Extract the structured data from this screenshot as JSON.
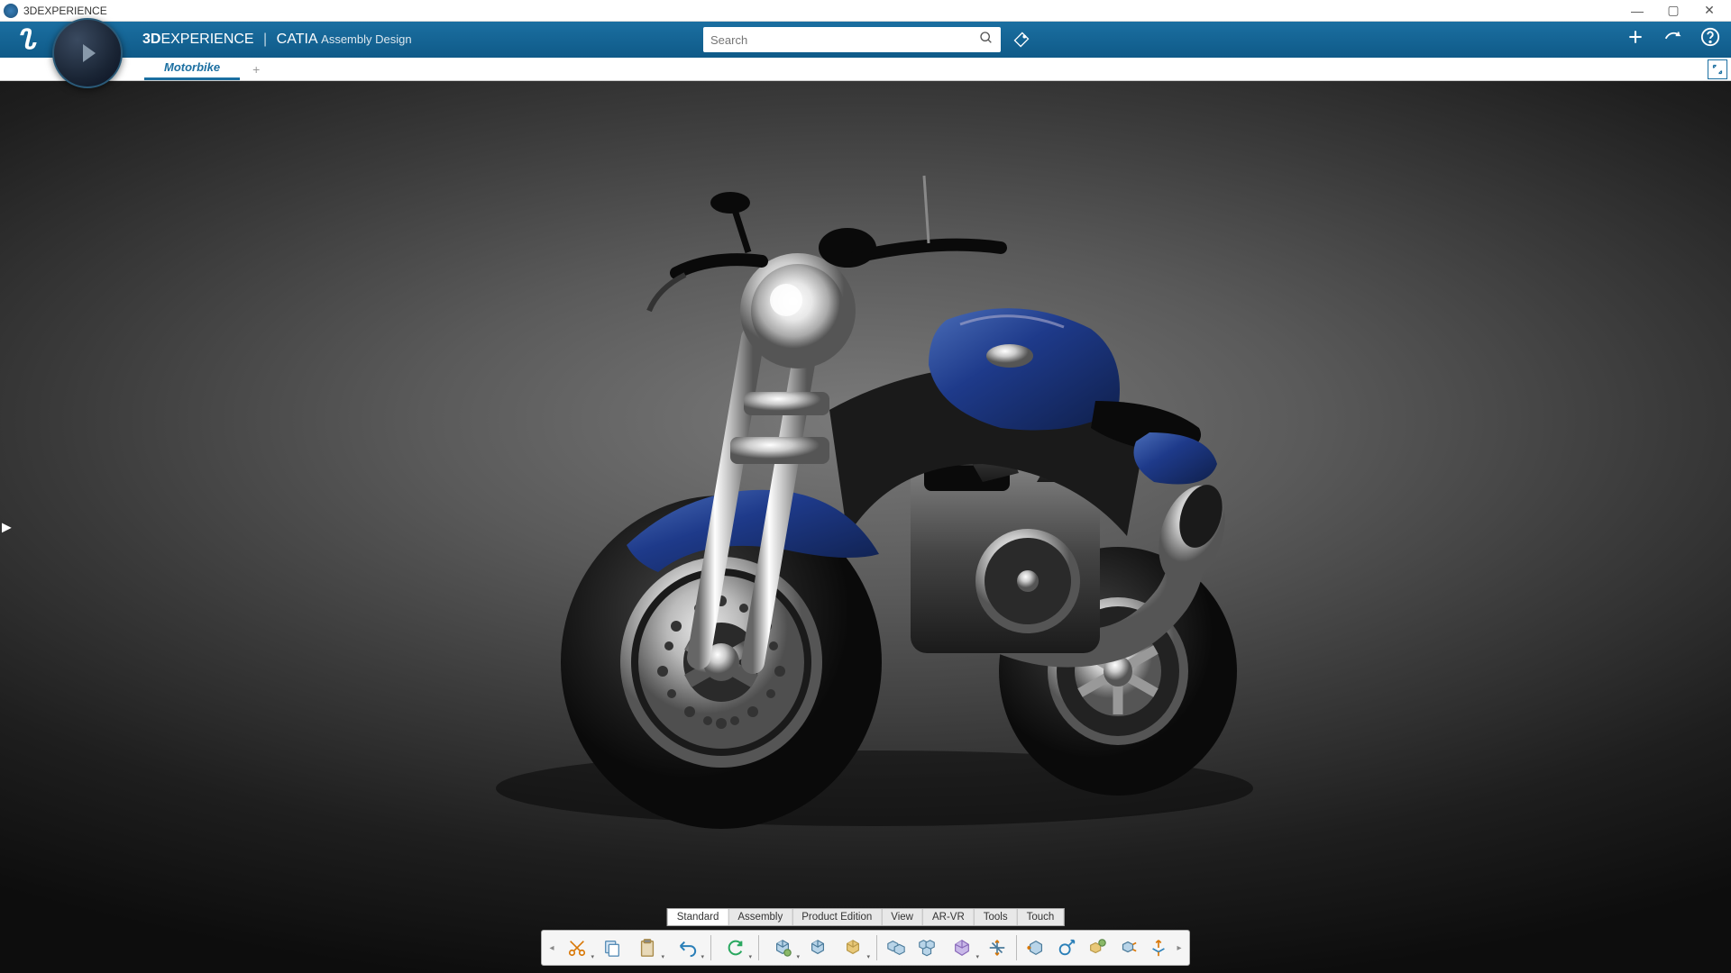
{
  "window": {
    "title": "3DEXPERIENCE"
  },
  "header": {
    "brand_prefix": "3D",
    "brand_main": "EXPERIENCE",
    "app": "CATIA",
    "module": "Assembly Design"
  },
  "search": {
    "placeholder": "Search"
  },
  "tabs": {
    "active": "Motorbike"
  },
  "bottom_tabs": [
    "Standard",
    "Assembly",
    "Product Edition",
    "View",
    "AR-VR",
    "Tools",
    "Touch"
  ],
  "bottom_tabs_active_index": 0,
  "toolbar_icons": [
    "expand-left",
    "cut",
    "copy",
    "paste",
    "undo",
    "update",
    "sub-product",
    "product",
    "component",
    "engineering-connection",
    "all-constraints",
    "flexible-rigid",
    "manipulation",
    "fast-multi",
    "snap",
    "fit-all",
    "explode",
    "smart-move"
  ],
  "colors": {
    "primary": "#0f5a88",
    "tank_blue": "#1e3a8a",
    "chrome": "#c0c0c0"
  }
}
